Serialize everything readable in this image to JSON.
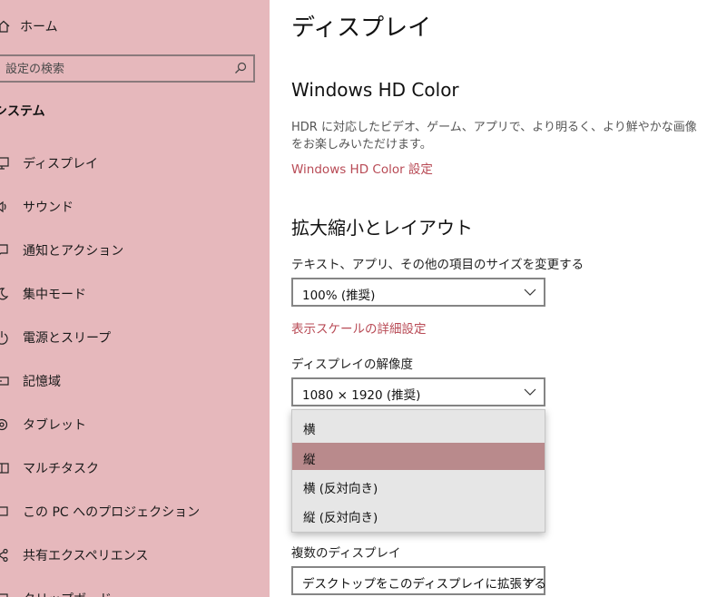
{
  "sidebar": {
    "home_label": "ホーム",
    "search_placeholder": "設定の検索",
    "section_title": "システム",
    "items": [
      {
        "label": "ディスプレイ",
        "icon": "monitor-icon"
      },
      {
        "label": "サウンド",
        "icon": "speaker-icon"
      },
      {
        "label": "通知とアクション",
        "icon": "notification-icon"
      },
      {
        "label": "集中モード",
        "icon": "moon-icon"
      },
      {
        "label": "電源とスリープ",
        "icon": "power-icon"
      },
      {
        "label": "記憶域",
        "icon": "storage-icon"
      },
      {
        "label": "タブレット",
        "icon": "tablet-icon"
      },
      {
        "label": "マルチタスク",
        "icon": "multitask-icon"
      },
      {
        "label": "この PC へのプロジェクション",
        "icon": "projection-icon"
      },
      {
        "label": "共有エクスペリエンス",
        "icon": "share-icon"
      },
      {
        "label": "クリップボード",
        "icon": "clipboard-icon"
      }
    ]
  },
  "main": {
    "title": "ディスプレイ",
    "hdr": {
      "heading": "Windows HD Color",
      "description": "HDR に対応したビデオ、ゲーム、アプリで、より明るく、より鮮やかな画像をお楽しみいただけます。",
      "link": "Windows HD Color 設定"
    },
    "scale": {
      "heading": "拡大縮小とレイアウト",
      "text_size_label": "テキスト、アプリ、その他の項目のサイズを変更する",
      "text_size_value": "100% (推奨)",
      "advanced_link": "表示スケールの詳細設定",
      "resolution_label": "ディスプレイの解像度",
      "resolution_value": "1080 × 1920 (推奨)",
      "orientation_options": [
        "横",
        "縦",
        "横 (反対向き)",
        "縦 (反対向き)"
      ],
      "orientation_selected_index": 1
    },
    "multi": {
      "label": "複数のディスプレイ",
      "value": "デスクトップをこのディスプレイに拡張する"
    }
  },
  "colors": {
    "sidebar_bg": "#e6b8bc",
    "accent_link": "#b84a55",
    "selected_option": "#b98a8c"
  }
}
